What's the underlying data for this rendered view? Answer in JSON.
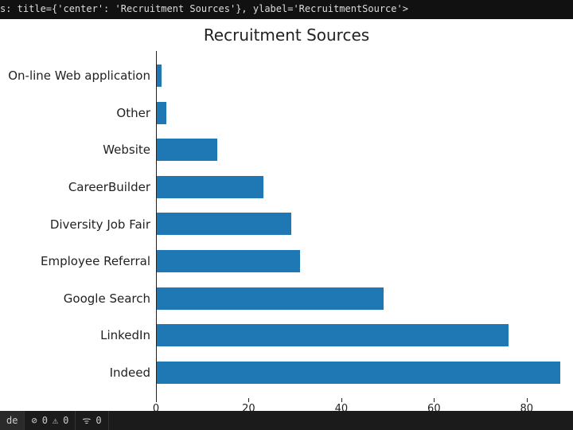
{
  "code_line": "s: title={'center': 'Recruitment Sources'}, ylabel='RecruitmentSource'>",
  "chart_data": {
    "type": "bar",
    "orientation": "horizontal",
    "title": "Recruitment Sources",
    "xlabel": "",
    "ylabel": "RecruitmentSource",
    "xlim": [
      0,
      90
    ],
    "xticks": [
      0,
      20,
      40,
      60,
      80
    ],
    "categories": [
      "On-line Web application",
      "Other",
      "Website",
      "CareerBuilder",
      "Diversity Job Fair",
      "Employee Referral",
      "Google Search",
      "LinkedIn",
      "Indeed"
    ],
    "values": [
      1,
      2,
      13,
      23,
      29,
      31,
      49,
      76,
      87
    ],
    "color": "#1f77b4"
  },
  "statusbar": {
    "left_label": "de",
    "no_error_icon": "⊘",
    "errors": "0",
    "warn_icon": "⚠",
    "warnings": "0",
    "radio_icon": "ᯤ",
    "radio": "0"
  }
}
